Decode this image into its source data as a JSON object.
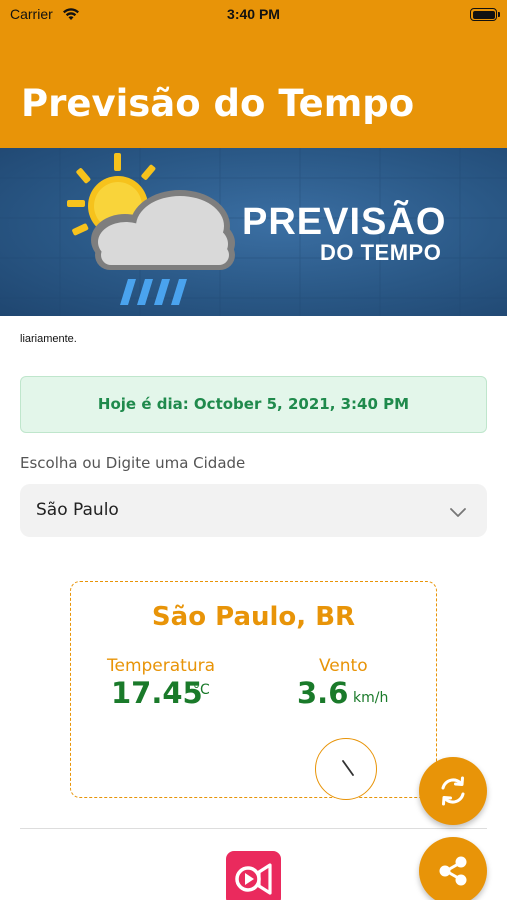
{
  "status_bar": {
    "carrier": "Carrier",
    "time": "3:40 PM"
  },
  "header": {
    "title": "Previsão do Tempo"
  },
  "banner": {
    "title_line1": "PREVISÃO",
    "title_line2": "DO TEMPO"
  },
  "intro_text": "liariamente.",
  "date_box": {
    "text": "Hoje é dia: October 5, 2021, 3:40 PM"
  },
  "city_select": {
    "label": "Escolha ou Digite uma Cidade",
    "value": "São Paulo"
  },
  "weather_card": {
    "city": "São Paulo, BR",
    "temperature_label": "Temperatura",
    "temperature_value": "17.45",
    "temperature_unit": "°C",
    "wind_label": "Vento",
    "wind_value": "3.6",
    "wind_unit": "km/h"
  },
  "colors": {
    "accent": "#e89408",
    "success_bg": "#e3f6ea",
    "success_text": "#1f8a4c",
    "value_green": "#1a7a2a",
    "logo_pink": "#ea2a5d"
  },
  "icons": {
    "wifi": "wifi-icon",
    "battery": "battery-icon",
    "chevron": "chevron-down-icon",
    "refresh": "refresh-icon",
    "share": "share-icon",
    "compass": "wind-compass-icon"
  }
}
